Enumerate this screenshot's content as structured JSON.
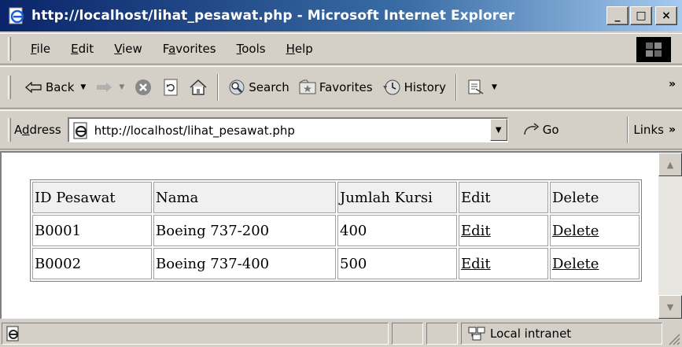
{
  "window": {
    "title": "http://localhost/lihat_pesawat.php - Microsoft Internet Explorer",
    "minimize": "_",
    "maximize": "□",
    "close": "×"
  },
  "menu": {
    "items": [
      {
        "label": "File",
        "key": "F",
        "rest": "ile"
      },
      {
        "label": "Edit",
        "key": "E",
        "rest": "dit"
      },
      {
        "label": "View",
        "key": "V",
        "rest": "iew"
      },
      {
        "label": "Favorites",
        "pre": "F",
        "key": "a",
        "rest": "vorites"
      },
      {
        "label": "Tools",
        "key": "T",
        "rest": "ools"
      },
      {
        "label": "Help",
        "key": "H",
        "rest": "elp"
      }
    ]
  },
  "toolbar": {
    "back": "Back",
    "search": "Search",
    "favorites": "Favorites",
    "history": "History",
    "more": "»"
  },
  "address": {
    "label_pre": "A",
    "label_key": "d",
    "label_rest": "dress",
    "url": "http://localhost/lihat_pesawat.php",
    "go": "Go",
    "links": "Links",
    "more": "»"
  },
  "table": {
    "headers": [
      "ID Pesawat",
      "Nama",
      "Jumlah Kursi",
      "Edit",
      "Delete"
    ],
    "rows": [
      {
        "id": "B0001",
        "nama": "Boeing 737-200",
        "kursi": "400",
        "edit": "Edit",
        "delete": "Delete"
      },
      {
        "id": "B0002",
        "nama": "Boeing 737-400",
        "kursi": "500",
        "edit": "Edit",
        "delete": "Delete"
      }
    ]
  },
  "status": {
    "zone": "Local intranet"
  },
  "colors": {
    "titlebar_start": "#0a246a",
    "titlebar_end": "#a6caf0",
    "chrome": "#d4d0c8"
  }
}
